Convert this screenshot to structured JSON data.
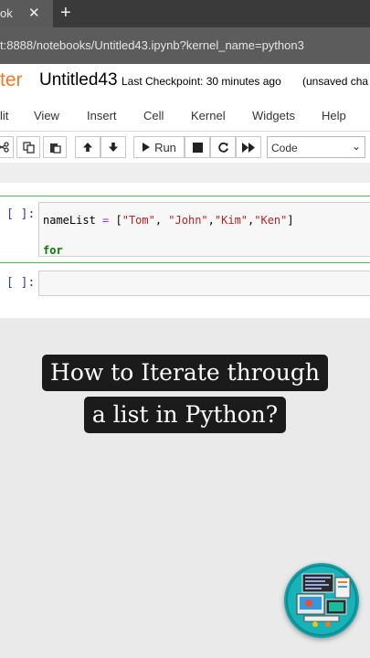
{
  "browser": {
    "tab_label": "ok",
    "tab_close": "✕",
    "new_tab": "+",
    "url": "t:8888/notebooks/Untitled43.ipynb?kernel_name=python3"
  },
  "jupyter": {
    "logo_text": "ter",
    "notebook_title": "Untitled43",
    "checkpoint": "Last Checkpoint: 30 minutes ago",
    "unsaved": "(unsaved cha"
  },
  "menu": [
    "lit",
    "View",
    "Insert",
    "Cell",
    "Kernel",
    "Widgets",
    "Help"
  ],
  "toolbar": {
    "run_label": "Run",
    "cell_type": "Code"
  },
  "cells": [
    {
      "prompt": "[ ]:",
      "code": {
        "var": "nameList",
        "op": " = ",
        "bracket_open": "[",
        "items": [
          "\"Tom\"",
          ", ",
          "\"John\"",
          ",",
          "\"Kim\"",
          ",",
          "\"Ken\""
        ],
        "bracket_close": "]"
      },
      "line2": "for"
    },
    {
      "prompt": "[ ]:"
    }
  ],
  "caption": {
    "line1": "How to Iterate through",
    "line2": "a list in Python?"
  },
  "colors": {
    "jupyter_orange": "#f37726",
    "cell_border": "#55b55b",
    "caption_bg": "#1b1b1b",
    "badge": "#13a3a9"
  }
}
